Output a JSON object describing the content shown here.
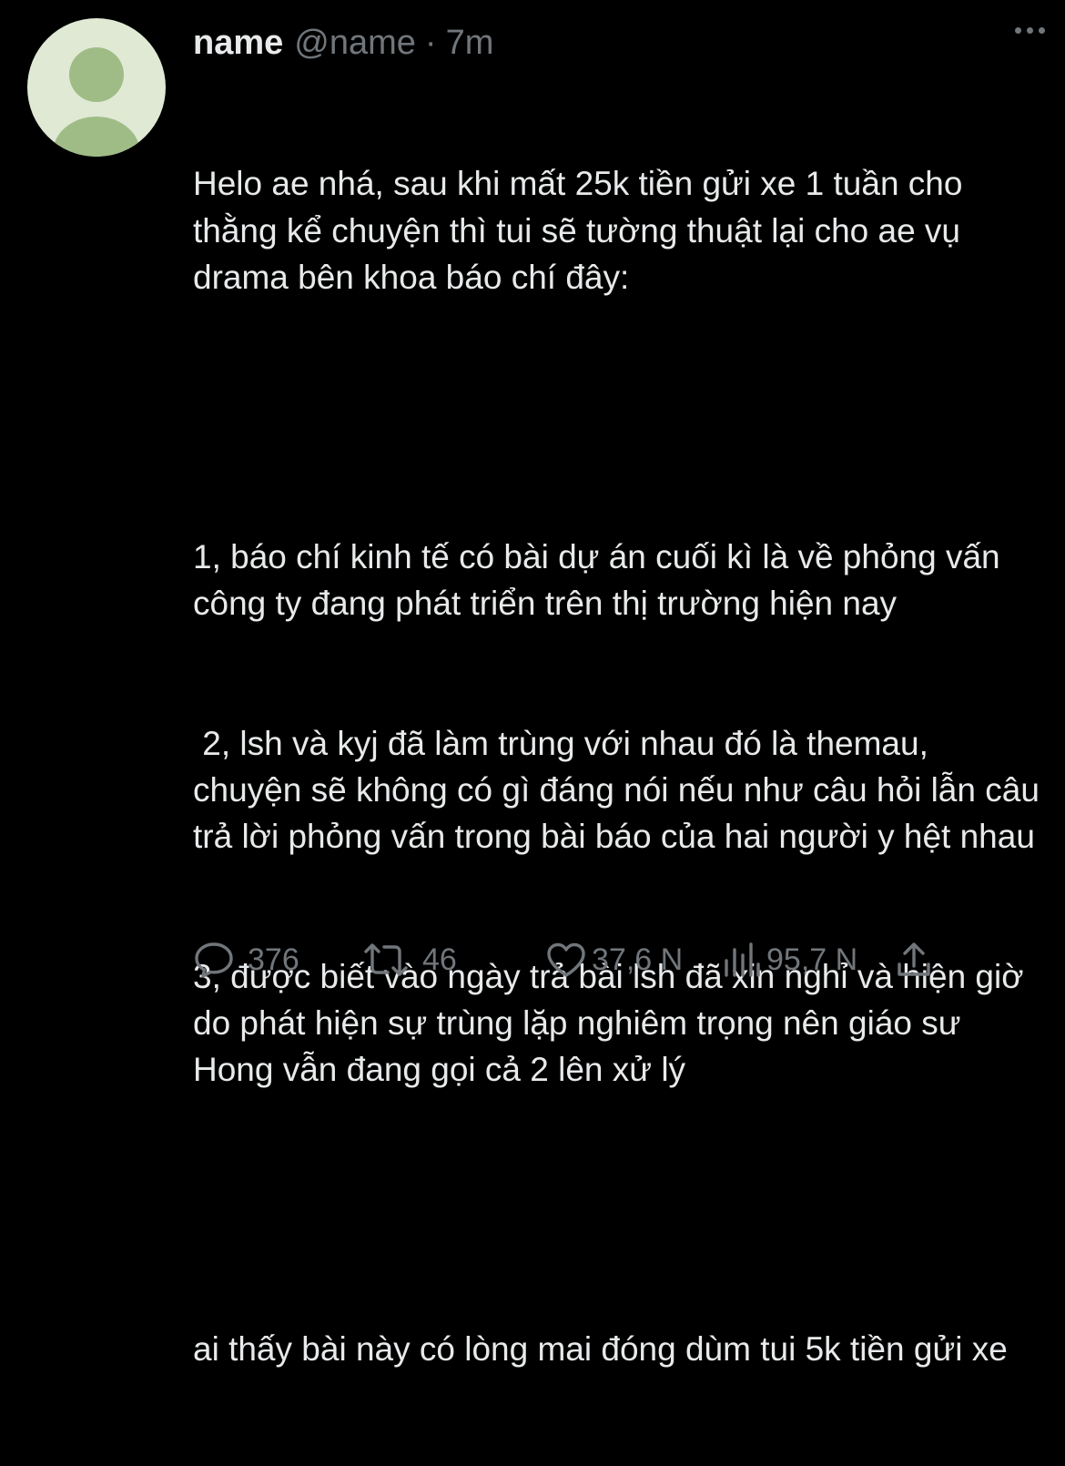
{
  "author": {
    "display_name": "name",
    "handle": "@name",
    "separator": "·",
    "time": "7m"
  },
  "tweet": {
    "paragraphs": [
      "Helo ae nhá, sau khi mất 25k tiền gửi xe 1 tuần cho thằng kể chuyện thì tui sẽ tường thuật lại cho ae vụ drama bên khoa báo chí đây:",
      "",
      "1, báo chí kinh tế có bài dự án cuối kì là về phỏng vấn công ty đang phát triển trên thị trường hiện nay",
      " 2, lsh và kyj đã làm trùng với nhau đó là themau, chuyện sẽ không có gì đáng nói nếu như câu hỏi lẫn câu trả lời phỏng vấn trong bài báo của hai người y hệt nhau",
      "3, được biết vào ngày trả bài lsh đã xin nghỉ và hiện giờ do phát hiện sự trùng lặp nghiêm trọng nên giáo sư Hong vẫn đang gọi cả 2 lên xử lý",
      "",
      "ai thấy bài này có lòng mai đóng dùm tui 5k tiền gửi xe"
    ]
  },
  "actions": {
    "reply_count": "376",
    "retweet_count": "46",
    "like_count": "37,6 N",
    "views_count": "95,7 N"
  },
  "icons": {
    "reply": "reply-icon",
    "retweet": "retweet-icon",
    "like": "heart-icon",
    "views": "views-icon",
    "share": "share-icon",
    "more": "more-options-icon"
  },
  "colors": {
    "background": "#000000",
    "text_primary": "#e7e9ea",
    "text_secondary": "#71767b",
    "avatar_bg": "#dfe9d4",
    "avatar_fg": "#9fbc86"
  }
}
